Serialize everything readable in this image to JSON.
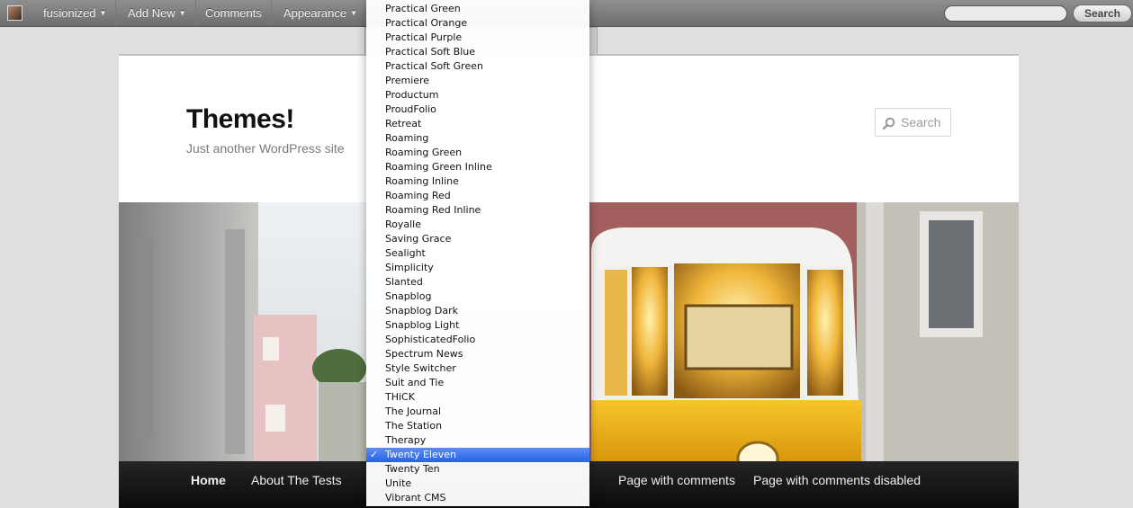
{
  "admin_bar": {
    "site_name": "fusionized",
    "add_new": "Add New",
    "comments": "Comments",
    "appearance": "Appearance",
    "search_button": "Search",
    "search_value": ""
  },
  "site": {
    "title": "Themes!",
    "description": "Just another WordPress site",
    "search_placeholder": "Search"
  },
  "nav": {
    "items": [
      "Home",
      "About The Tests",
      "",
      "",
      "",
      "",
      "Page with comments",
      "Page with comments disabled"
    ]
  },
  "theme_menu": {
    "options": [
      "Practical Green",
      "Practical Orange",
      "Practical Purple",
      "Practical Soft Blue",
      "Practical Soft Green",
      "Premiere",
      "Productum",
      "ProudFolio",
      "Retreat",
      "Roaming",
      "Roaming Green",
      "Roaming Green Inline",
      "Roaming Inline",
      "Roaming Red",
      "Roaming Red Inline",
      "Royalle",
      "Saving Grace",
      "Sealight",
      "Simplicity",
      "Slanted",
      "Snapblog",
      "Snapblog Dark",
      "Snapblog Light",
      "SophisticatedFolio",
      "Spectrum News",
      "Style Switcher",
      "Suit and Tie",
      "THiCK",
      "The Journal",
      "The Station",
      "Therapy",
      "Twenty Eleven",
      "Twenty Ten",
      "Unite",
      "Vibrant CMS"
    ],
    "selected": "Twenty Eleven",
    "check_glyph": "✓"
  },
  "colors": {
    "selection": "#2f6ae8",
    "nav_bg": "#111111",
    "tram_yellow": "#f2b619"
  }
}
